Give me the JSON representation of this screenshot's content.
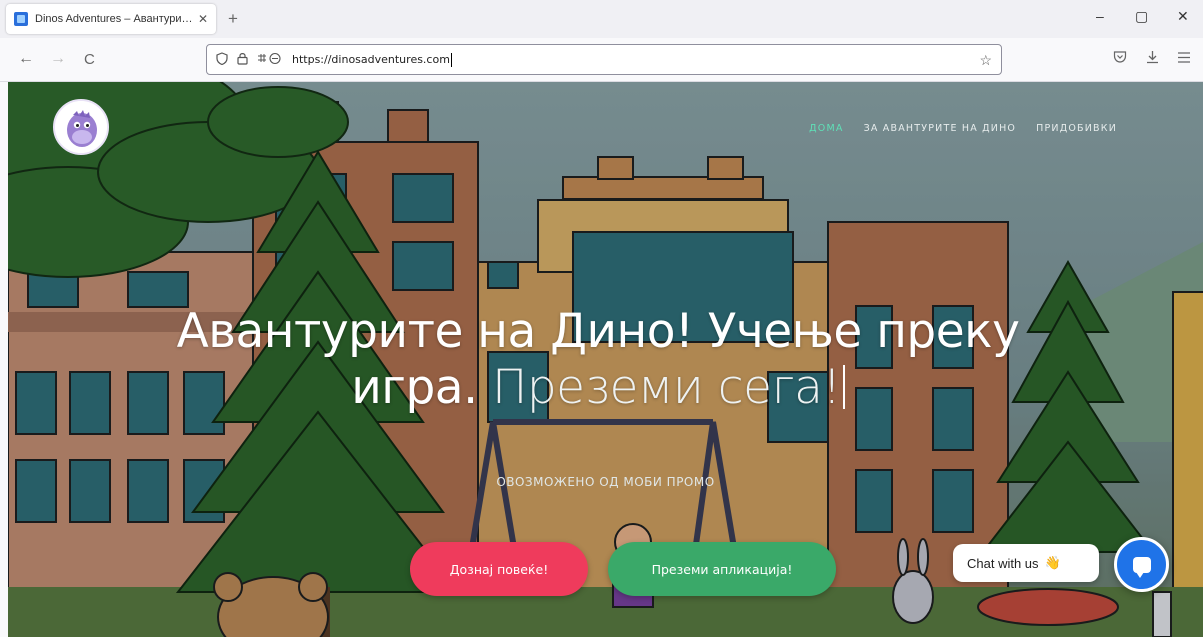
{
  "browser": {
    "tab": {
      "title": "Dinos Adventures – Авантури…",
      "close": "✕"
    },
    "new_tab": "+",
    "window_controls": {
      "minimize": "–",
      "maximize": "▢",
      "close": "✕"
    },
    "nav": {
      "back": "←",
      "forward": "→",
      "reload": "C"
    },
    "url": "https://dinosadventures.com",
    "url_icons": [
      "shield-icon",
      "lock-icon",
      "permissions-icon"
    ],
    "right_icons": [
      "pocket-icon",
      "download-icon",
      "menu-icon"
    ]
  },
  "site": {
    "nav": [
      {
        "label": "ДОМА",
        "active": true
      },
      {
        "label": "ЗА АВАНТУРИТЕ НА ДИНО",
        "active": false
      },
      {
        "label": "ПРИДОБИВКИ",
        "active": false
      }
    ],
    "headline": {
      "line1": "Авантурите на Дино! Учење преку",
      "line2_static": "игра.",
      "line2_typed": "Преземи сега!"
    },
    "powered_by": "ОВОЗМОЖЕНО ОД МОБИ ПРОМО",
    "buttons": {
      "learn_more": "Дознај повеќе!",
      "download_app": "Преземи апликација!"
    },
    "chat": {
      "label": "Chat with us",
      "wave": "👋"
    }
  },
  "colors": {
    "nav_active": "#5fe0b7",
    "learn_more_bg": "#ef3b5c",
    "download_bg": "#3aa969",
    "chat_button_bg": "#1f73e8"
  }
}
